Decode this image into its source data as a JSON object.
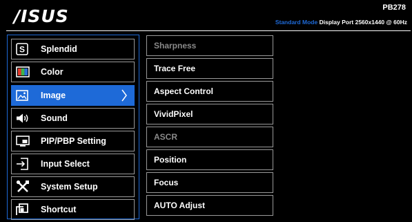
{
  "header": {
    "logo": "/ISUS",
    "model": "PB278",
    "mode": "Standard Mode",
    "input": "Display Port",
    "resolution": "2560x1440 @ 60Hz"
  },
  "main_menu": [
    {
      "label": "Splendid",
      "icon": "splendid-icon"
    },
    {
      "label": "Color",
      "icon": "color-icon"
    },
    {
      "label": "Image",
      "icon": "image-icon",
      "active": true
    },
    {
      "label": "Sound",
      "icon": "speaker-icon"
    },
    {
      "label": "PIP/PBP Setting",
      "icon": "pip-icon"
    },
    {
      "label": "Input Select",
      "icon": "input-select-icon"
    },
    {
      "label": "System Setup",
      "icon": "tools-icon"
    },
    {
      "label": "Shortcut",
      "icon": "shortcut-icon"
    }
  ],
  "submenu": [
    {
      "label": "Sharpness",
      "enabled": false
    },
    {
      "label": "Trace Free",
      "enabled": true
    },
    {
      "label": "Aspect Control",
      "enabled": true
    },
    {
      "label": "VividPixel",
      "enabled": true
    },
    {
      "label": "ASCR",
      "enabled": false
    },
    {
      "label": "Position",
      "enabled": true
    },
    {
      "label": "Focus",
      "enabled": true
    },
    {
      "label": "AUTO Adjust",
      "enabled": true
    }
  ],
  "colors": {
    "accent": "#1e6ad8",
    "border": "#9a9a9a",
    "disabled_text": "#8a8a8a"
  }
}
